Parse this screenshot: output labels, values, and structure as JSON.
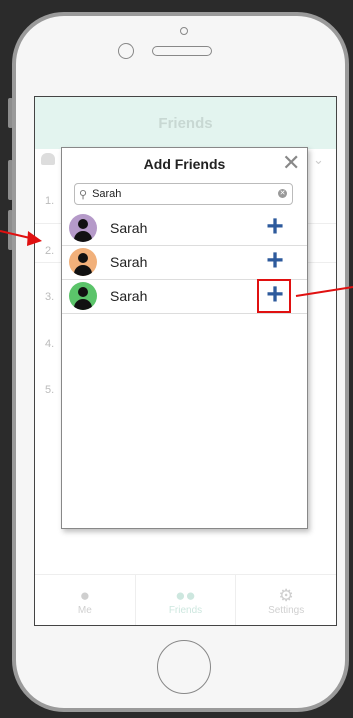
{
  "app": {
    "header_title": "Friends",
    "bg_row_numbers": [
      "1.",
      "2.",
      "3.",
      "4.",
      "5."
    ]
  },
  "modal": {
    "title": "Add Friends",
    "close_icon": "✕",
    "search": {
      "value": "Sarah",
      "placeholder": "Search"
    },
    "results": [
      {
        "name": "Sarah",
        "avatar_color": "#b59ac9"
      },
      {
        "name": "Sarah",
        "avatar_color": "#f1b07a"
      },
      {
        "name": "Sarah",
        "avatar_color": "#5bc46a"
      }
    ],
    "add_icon": "+"
  },
  "tabbar": {
    "tabs": [
      {
        "label": "Me",
        "icon": "person-icon"
      },
      {
        "label": "Friends",
        "icon": "group-icon"
      },
      {
        "label": "Settings",
        "icon": "gear-icon"
      }
    ]
  },
  "colors": {
    "header_bg": "#e3f4ef",
    "add_button": "#2d5a9c",
    "annotation_red": "#e01010"
  }
}
